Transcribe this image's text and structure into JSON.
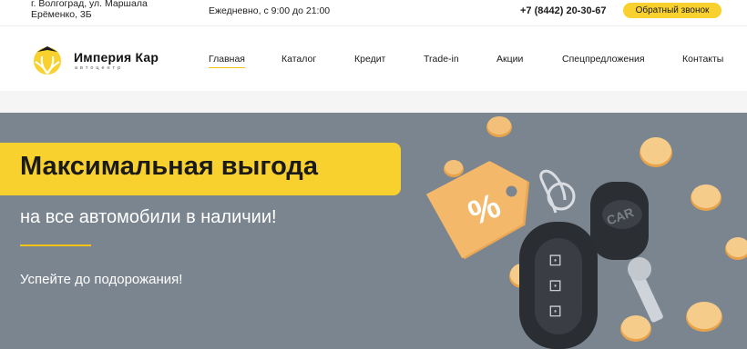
{
  "topbar": {
    "address_line1": "г. Волгоград, ул. Маршала",
    "address_line2": "Ерёменко, 3Б",
    "hours": "Ежедневно, с 9:00 до 21:00",
    "phone": "+7 (8442) 20-30-67",
    "callback_label": "Обратный звонок"
  },
  "brand": {
    "name": "Империя Кар",
    "subtitle": "автоцентр"
  },
  "nav": {
    "items": [
      {
        "label": "Главная",
        "active": true
      },
      {
        "label": "Каталог"
      },
      {
        "label": "Кредит"
      },
      {
        "label": "Trade-in"
      },
      {
        "label": "Акции"
      },
      {
        "label": "Спецпредложения"
      },
      {
        "label": "Контакты"
      }
    ]
  },
  "hero": {
    "title": "Максимальная выгода",
    "subtitle": "на все автомобили в наличии!",
    "note": "Успейте до подорожания!",
    "tag_symbol": "%",
    "key_fob_text": "CAR"
  },
  "colors": {
    "accent": "#f8d12e",
    "hero_bg": "#7b8590",
    "text_dark": "#1a1a1a"
  },
  "icons": [
    "logo-mark",
    "percent-tag",
    "car-key",
    "coin"
  ]
}
